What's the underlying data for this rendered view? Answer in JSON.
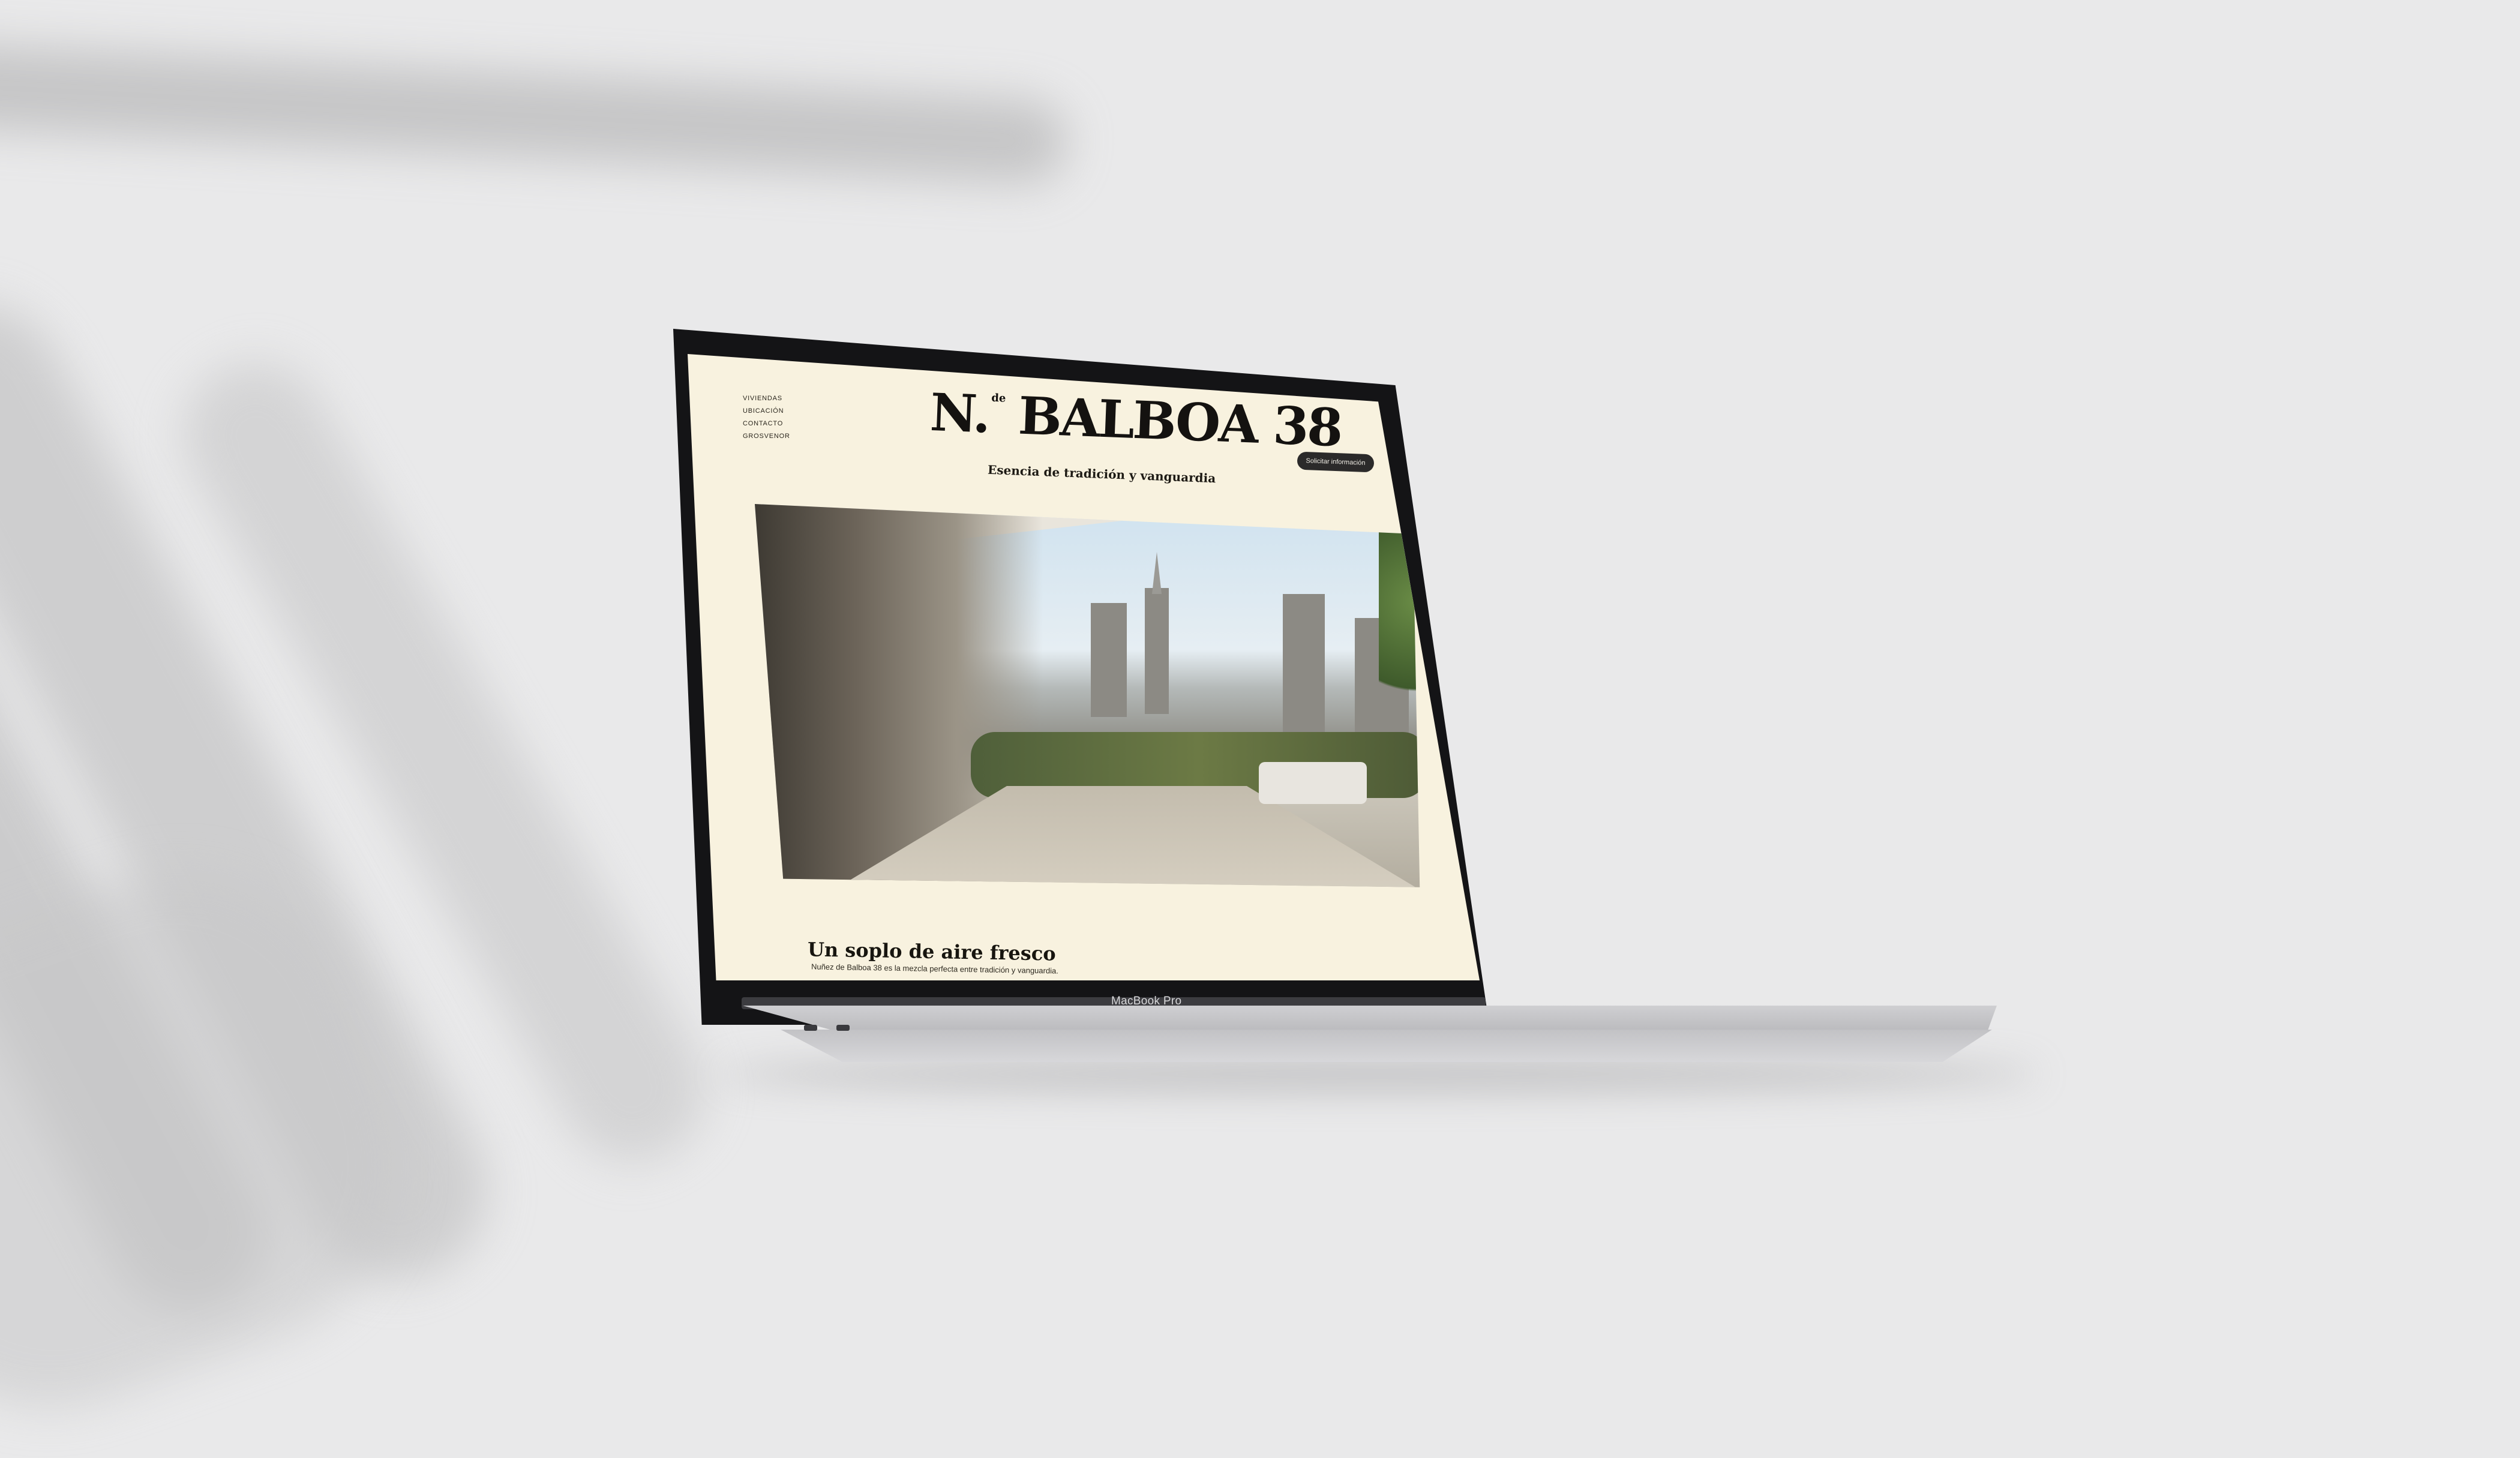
{
  "nav": {
    "items": [
      "VIVIENDAS",
      "UBICACIÓN",
      "CONTACTO",
      "GROSVENOR"
    ]
  },
  "logo": {
    "prefix": "N.",
    "superscript": "de",
    "name": "BALBOA 38"
  },
  "tagline": "Esencia de tradición y vanguardia",
  "cta_label": "Solicitar información",
  "section": {
    "title": "Un soplo de aire fresco",
    "text": "Nuñez de Balboa 38 es la mezcla perfecta entre tradición y vanguardia."
  },
  "device": {
    "label": "MacBook Pro"
  },
  "colors": {
    "page_background": "#f8f2df",
    "button": "#2b2a2a",
    "text": "#141210"
  }
}
